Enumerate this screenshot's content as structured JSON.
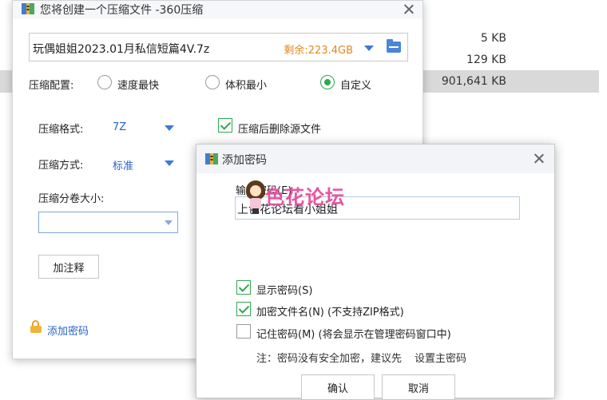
{
  "explorer": {
    "sizes": [
      "5 KB",
      "129 KB",
      "901,641 KB"
    ]
  },
  "main": {
    "title": "您将创建一个压缩文件 -360压缩",
    "filename": "玩偶姐姐2023.01月私信短篇4V.7z",
    "space_left": "剩余:223.4GB",
    "config_label": "压缩配置:",
    "radios": [
      {
        "label": "速度最快",
        "checked": false
      },
      {
        "label": "体积最小",
        "checked": false
      },
      {
        "label": "自定义",
        "checked": true
      }
    ],
    "format_label": "压缩格式:",
    "format_value": "7Z",
    "method_label": "压缩方式:",
    "method_value": "标准",
    "volume_label": "压缩分卷大小:",
    "volume_value": "",
    "delete_source_label": "压缩后删除源文件",
    "delete_source_checked": true,
    "comment_button": "加注释",
    "add_password_link": "添加密码"
  },
  "pw": {
    "title": "添加密码",
    "input_label": "输入密码(E)",
    "input_value": "上色花论坛看小姐姐",
    "watermark": "色花论坛",
    "options": [
      {
        "label": "显示密码(S)",
        "checked": true
      },
      {
        "label": "加密文件名(N) (不支持ZIP格式)",
        "checked": true
      },
      {
        "label": "记住密码(M) (将会显示在管理密码窗口中)",
        "checked": false
      }
    ],
    "note_prefix": "注：密码没有安全加密，建议先",
    "note_link": "设置主密码",
    "ok_button": "确认",
    "cancel_button": "取消"
  },
  "colors": {
    "accent_green": "#2fa84f",
    "link_blue": "#2a63c7",
    "space_orange": "#e08a1e",
    "watermark_pink": "#e84a9a"
  }
}
